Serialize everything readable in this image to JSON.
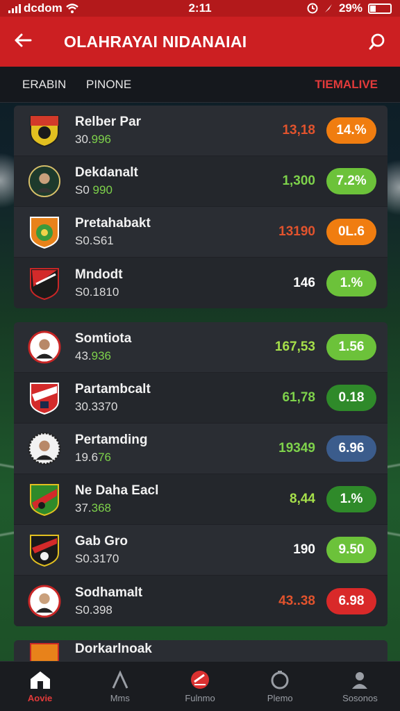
{
  "status_bar": {
    "carrier": "dcdom",
    "time": "2:11",
    "battery": "29%"
  },
  "header": {
    "title": "OLAHRAYAI NIDANAIAI"
  },
  "subheader": {
    "col1": "ERABIN",
    "col2": "PINONE",
    "col3": "TIEMALIVE"
  },
  "colors": {
    "accent": "#cc1f22",
    "orange": "#f07d10",
    "bright_green": "#6cc23a",
    "dark_green": "#2f8a2a",
    "blue": "#3b5c8c",
    "red": "#d92929"
  },
  "groups": [
    {
      "rows": [
        {
          "name": "Relber Par",
          "sub_a": "30.",
          "sub_b": "996",
          "value": "13,18",
          "value_color": "#e2532d",
          "pill": "14.%",
          "pill_color": "#f07d10",
          "crest": "yellow-black-shield"
        },
        {
          "name": "Dekdanalt",
          "sub_a": "S0 ",
          "sub_b": "990",
          "value": "1,300",
          "value_color": "#7ed24b",
          "pill": "7.2%",
          "pill_color": "#6cc23a",
          "crest": "player-portrait"
        },
        {
          "name": "Pretahabakt",
          "sub_a": "S0.S61",
          "sub_b": "",
          "value": "13190",
          "value_color": "#e2532d",
          "pill": "0L.6",
          "pill_color": "#f07d10",
          "crest": "green-orange-badge"
        },
        {
          "name": "Mndodt",
          "sub_a": "S0.1810",
          "sub_b": "",
          "value": "146",
          "value_color": "#ffffff",
          "pill": "1.%",
          "pill_color": "#6cc23a",
          "crest": "red-black-shield"
        }
      ]
    },
    {
      "rows": [
        {
          "name": "Somtiota",
          "sub_a": "43.",
          "sub_b": "936",
          "value": "167,53",
          "value_color": "#a6e04a",
          "pill": "1.56",
          "pill_color": "#6cc23a",
          "crest": "player-portrait-red"
        },
        {
          "name": "Partambcalt",
          "sub_a": "30.3370",
          "sub_b": "",
          "value": "61,78",
          "value_color": "#7ed24b",
          "pill": "0.18",
          "pill_color": "#2f8a2a",
          "crest": "red-white-shield"
        },
        {
          "name": "Pertamding",
          "sub_a": "19.6",
          "sub_b": "76",
          "value": "19349",
          "value_color": "#7ed24b",
          "pill": "6.96",
          "pill_color": "#3b5c8c",
          "crest": "player-portrait-dark"
        },
        {
          "name": "Ne Daha Eacl",
          "sub_a": "37.",
          "sub_b": "368",
          "value": "8,44",
          "value_color": "#a6e04a",
          "pill": "1.%",
          "pill_color": "#2f8a2a",
          "crest": "green-red-shield"
        },
        {
          "name": "Gab Gro",
          "sub_a": "S0.3170",
          "sub_b": "",
          "value": "190",
          "value_color": "#ffffff",
          "pill": "9.50",
          "pill_color": "#6cc23a",
          "crest": "red-yellow-shield"
        },
        {
          "name": "Sodhamalt",
          "sub_a": "S0.398",
          "sub_b": "",
          "value": "43..38",
          "value_color": "#e2532d",
          "pill": "6.98",
          "pill_color": "#d92929",
          "crest": "player-portrait-white"
        }
      ]
    }
  ],
  "partial_row": {
    "name": "Dorkarlnoak"
  },
  "nav": [
    {
      "label": "Aovie",
      "icon": "home-icon",
      "active": true
    },
    {
      "label": "Mms",
      "icon": "triangle-icon",
      "active": false
    },
    {
      "label": "Fulnmo",
      "icon": "ball-icon",
      "active": false
    },
    {
      "label": "Plemo",
      "icon": "circle-icon",
      "active": false
    },
    {
      "label": "Sosonos",
      "icon": "person-icon",
      "active": false
    }
  ]
}
